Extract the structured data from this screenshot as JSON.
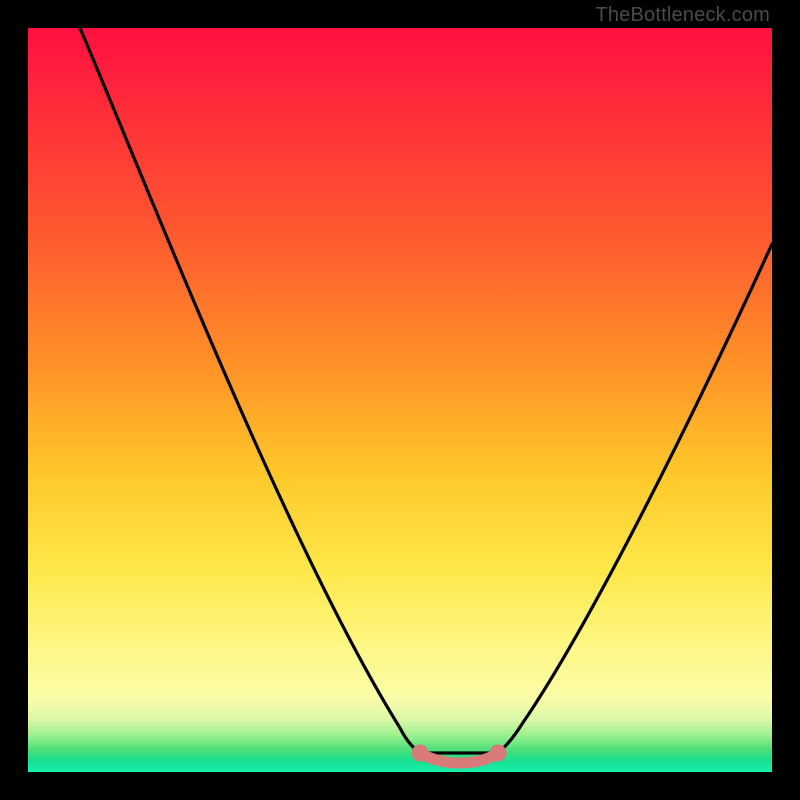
{
  "watermark": "TheBottleneck.com",
  "colors": {
    "curve": "#000000",
    "flat_segment": "#d87a78",
    "flat_endpoint_fill": "#d87a78",
    "gradient_top": "#ff1040",
    "gradient_bottom": "#16f0b0",
    "page_bg": "#000000"
  },
  "chart_data": {
    "type": "line",
    "title": "",
    "xlabel": "",
    "ylabel": "",
    "xlim": [
      0,
      100
    ],
    "ylim": [
      0,
      100
    ],
    "grid": false,
    "legend": false,
    "note": "No axis ticks or numeric labels are rendered; values are estimated from pixel positions within the 744x744 plot area.",
    "series": [
      {
        "name": "left-descent",
        "estimated": true,
        "x": [
          7,
          12,
          18,
          24,
          30,
          36,
          42,
          48,
          52.5
        ],
        "y": [
          100,
          88,
          75,
          62,
          49,
          36,
          23,
          10,
          2.5
        ]
      },
      {
        "name": "flat-bottom",
        "estimated": true,
        "x": [
          52.5,
          55,
          58,
          61,
          63.5
        ],
        "y": [
          2.5,
          1.8,
          1.6,
          1.8,
          2.5
        ]
      },
      {
        "name": "right-ascent",
        "estimated": true,
        "x": [
          63.5,
          68,
          74,
          80,
          86,
          92,
          98,
          100
        ],
        "y": [
          2.5,
          8,
          18,
          30,
          42,
          55,
          67,
          71
        ]
      }
    ],
    "flat_segment_endpoints": {
      "left": {
        "x": 52.5,
        "y": 2.5
      },
      "right": {
        "x": 63.5,
        "y": 2.5
      }
    }
  }
}
